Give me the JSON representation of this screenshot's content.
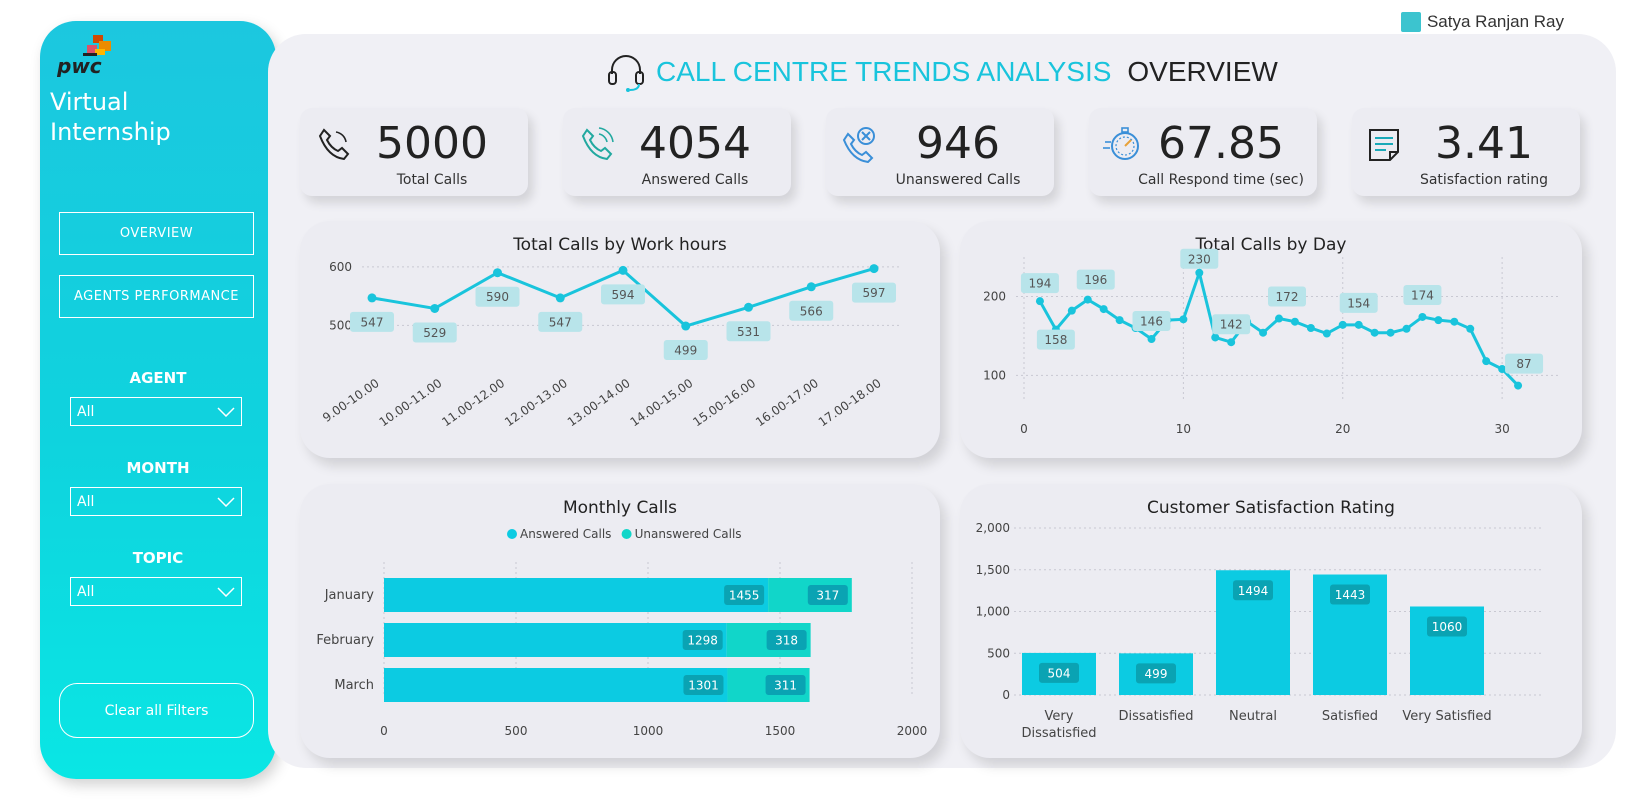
{
  "user": {
    "name": "Satya Ranjan Ray"
  },
  "sidebar": {
    "brand": "pwc",
    "title_line1": "Virtual",
    "title_line2": "Internship",
    "nav": [
      {
        "label": "OVERVIEW"
      },
      {
        "label": "AGENTS PERFORMANCE"
      }
    ],
    "filters": [
      {
        "label": "AGENT",
        "value": "All"
      },
      {
        "label": "MONTH",
        "value": "All"
      },
      {
        "label": "TOPIC",
        "value": "All"
      }
    ],
    "clear_label": "Clear all Filters"
  },
  "header": {
    "title": "CALL CENTRE TRENDS ANALYSIS",
    "subtitle": "OVERVIEW"
  },
  "kpis": [
    {
      "value": "5000",
      "label": "Total Calls",
      "icon": "phone-icon"
    },
    {
      "value": "4054",
      "label": "Answered Calls",
      "icon": "phone-ringing-icon"
    },
    {
      "value": "946",
      "label": "Unanswered Calls",
      "icon": "phone-missed-icon"
    },
    {
      "value": "67.85",
      "label": "Call Respond time (sec)",
      "icon": "stopwatch-icon"
    },
    {
      "value": "3.41",
      "label": "Satisfaction rating",
      "icon": "clipboard-icon"
    }
  ],
  "colors": {
    "accent": "#19c4dc",
    "bar_answered": "#0ccbe2",
    "bar_unanswered": "#11d6c9",
    "label_bg": "#b8e4ea"
  },
  "chart_data": [
    {
      "type": "line",
      "title": "Total Calls by Work hours",
      "categories": [
        "9.00-10.00",
        "10.00-11.00",
        "11.00-12.00",
        "12.00-13.00",
        "13.00-14.00",
        "14.00-15.00",
        "15.00-16.00",
        "16.00-17.00",
        "17.00-18.00"
      ],
      "values": [
        547,
        529,
        590,
        547,
        594,
        499,
        531,
        566,
        597
      ],
      "yticks": [
        500,
        600
      ],
      "ylim": [
        470,
        610
      ]
    },
    {
      "type": "line",
      "title": "Total Calls by Day",
      "x": [
        1,
        2,
        3,
        4,
        5,
        6,
        7,
        8,
        9,
        10,
        11,
        12,
        13,
        14,
        15,
        16,
        17,
        18,
        19,
        20,
        21,
        22,
        23,
        24,
        25,
        26,
        27,
        28,
        29,
        30,
        31
      ],
      "values": [
        194,
        158,
        182,
        196,
        184,
        170,
        160,
        146,
        170,
        171,
        230,
        148,
        142,
        168,
        154,
        172,
        168,
        160,
        153,
        164,
        164,
        154,
        154,
        159,
        174,
        170,
        168,
        159,
        118,
        108,
        87
      ],
      "labels": {
        "1": "194",
        "2": "158",
        "4": "196",
        "8": "146",
        "11": "230",
        "13": "142",
        "16": "172",
        "21": "154",
        "25": "174",
        "31": "87"
      },
      "xticks": [
        0,
        10,
        20,
        30
      ],
      "yticks": [
        100,
        200
      ],
      "xlim": [
        0,
        32
      ],
      "ylim": [
        70,
        250
      ]
    },
    {
      "type": "bar",
      "orientation": "horizontal",
      "stacked": true,
      "title": "Monthly Calls",
      "categories": [
        "January",
        "February",
        "March"
      ],
      "series": [
        {
          "name": "Answered Calls",
          "values": [
            1455,
            1298,
            1301
          ]
        },
        {
          "name": "Unanswered Calls",
          "values": [
            317,
            318,
            311
          ]
        }
      ],
      "xticks": [
        0,
        500,
        1000,
        1500,
        2000
      ],
      "xlim": [
        0,
        2000
      ]
    },
    {
      "type": "bar",
      "title": "Customer Satisfaction Rating",
      "categories": [
        "Very Dissatisfied",
        "Dissatisfied",
        "Neutral",
        "Satisfied",
        "Very Satisfied"
      ],
      "values": [
        504,
        499,
        1494,
        1443,
        1060
      ],
      "yticks": [
        "0",
        "500",
        "1,000",
        "1,500",
        "2,000"
      ],
      "ylim": [
        0,
        2000
      ]
    }
  ]
}
